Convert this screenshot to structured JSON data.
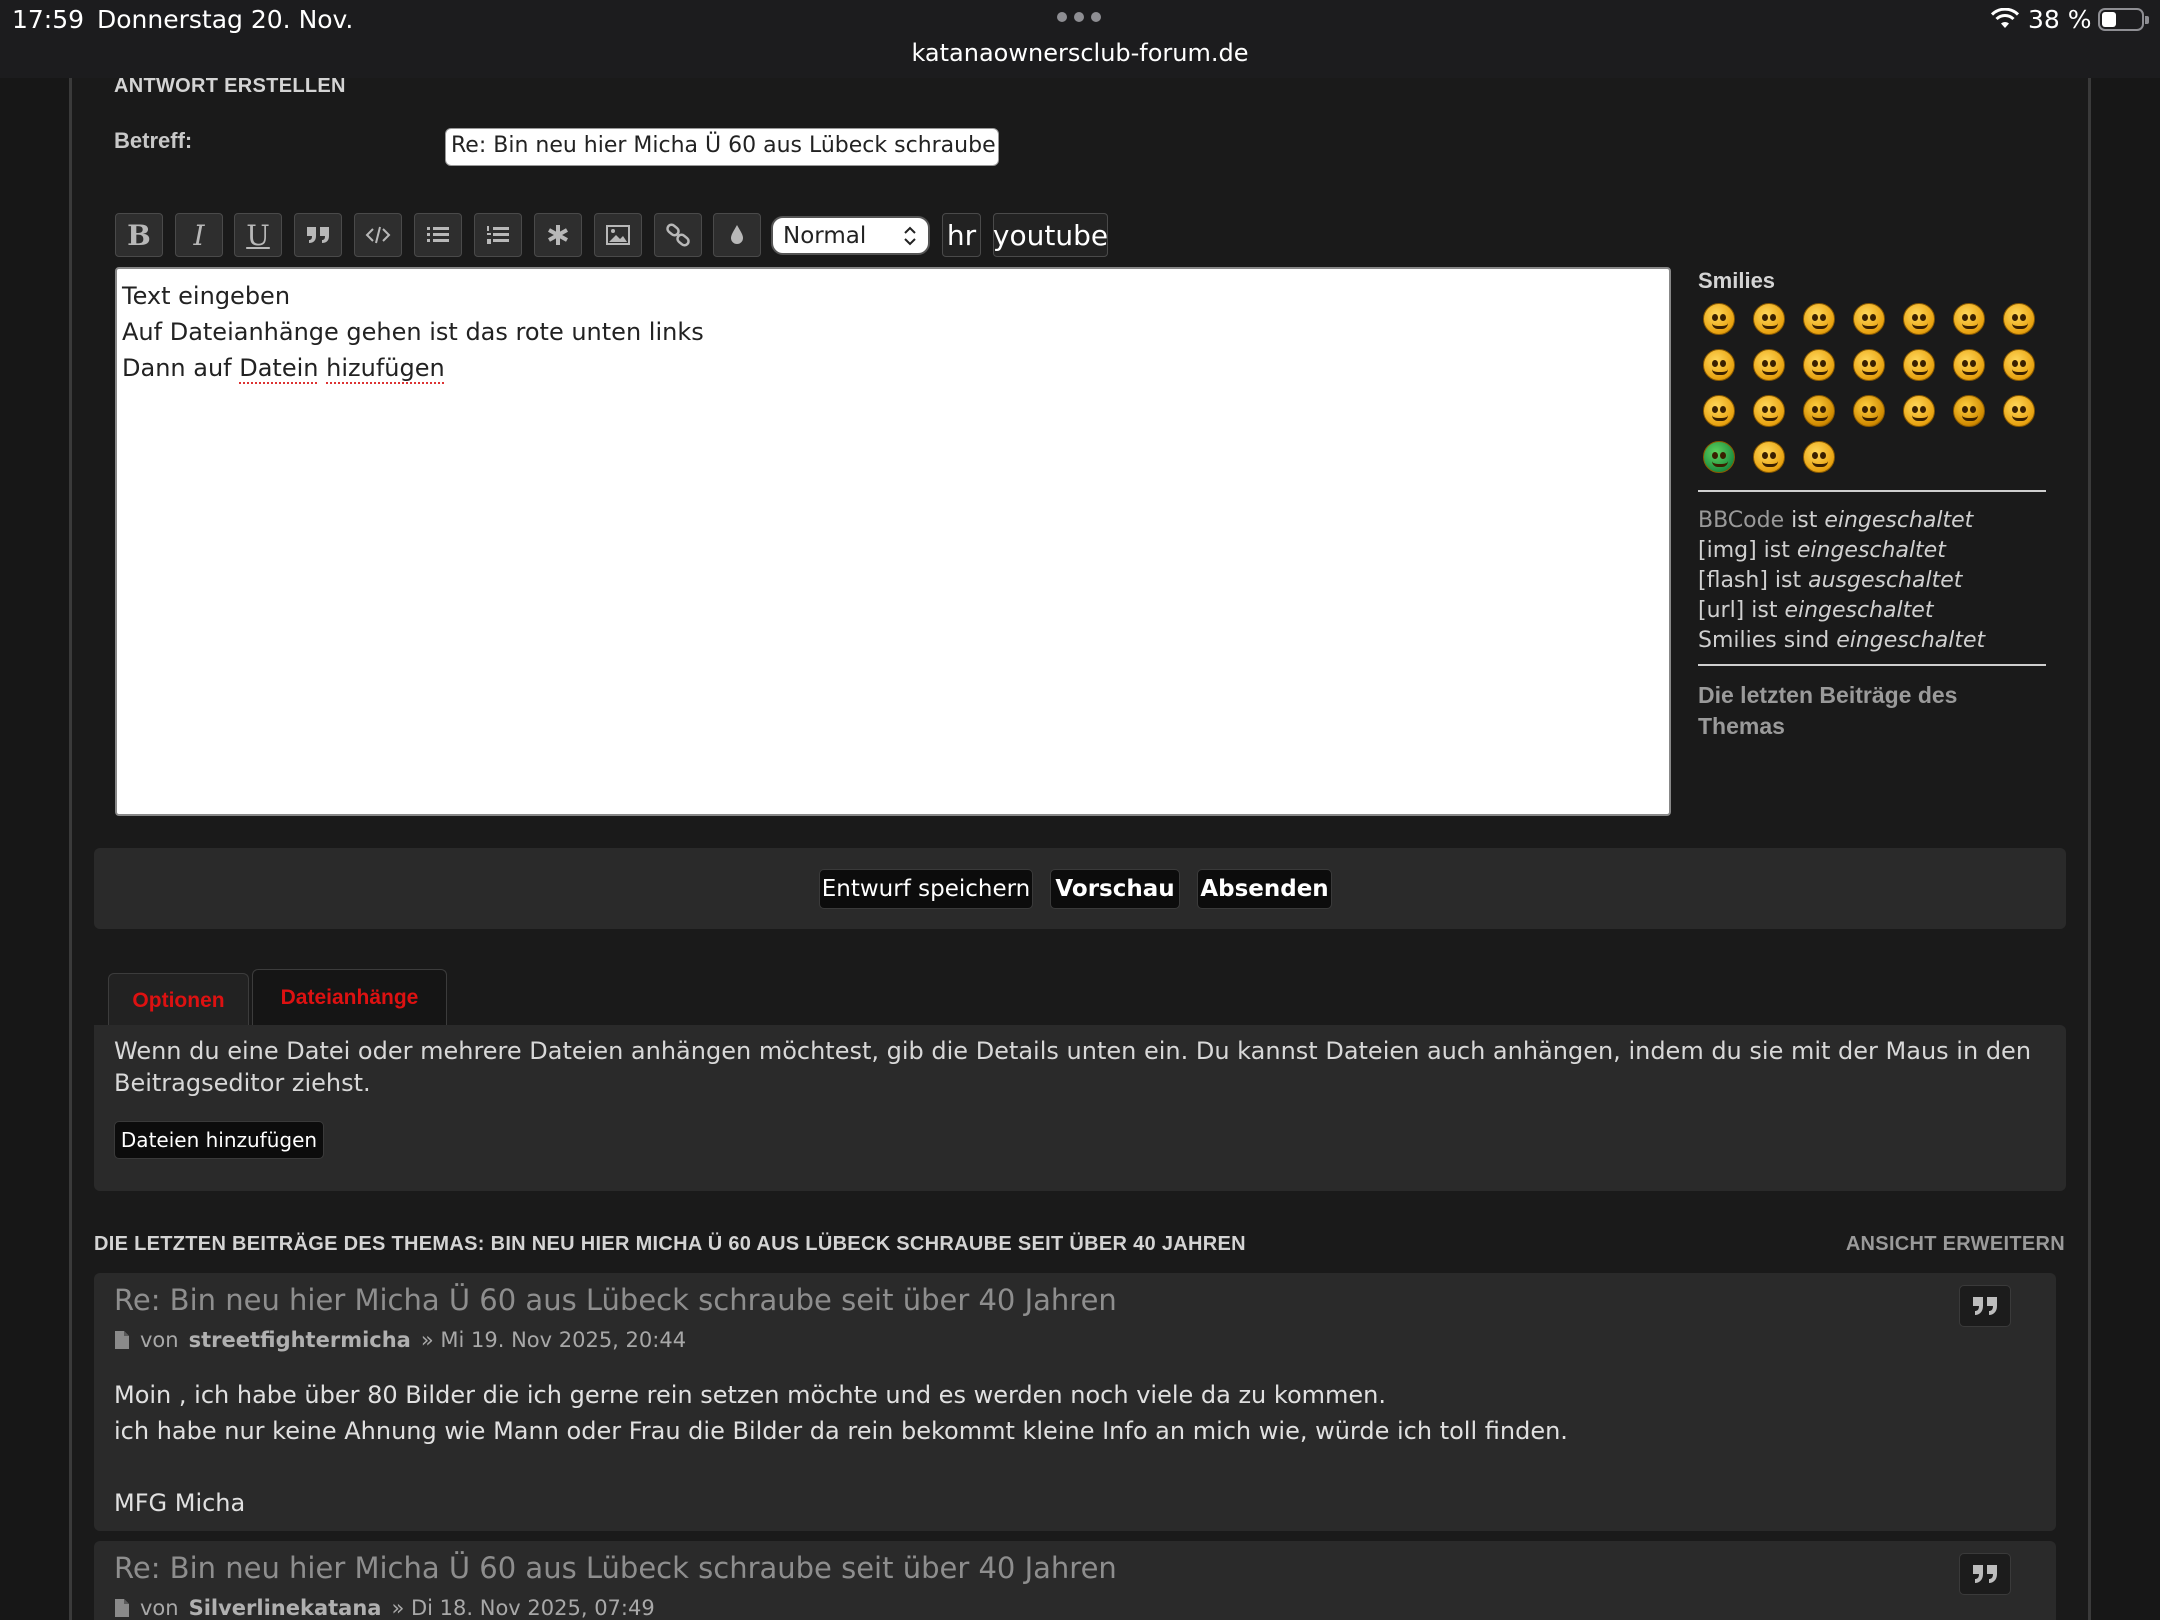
{
  "status_bar": {
    "time": "17:59",
    "date": "Donnerstag 20. Nov.",
    "url": "katanaownersclub-forum.de",
    "battery_percent": "38 %",
    "battery_level": 0.38
  },
  "reply_form": {
    "title": "ANTWORT ERSTELLEN",
    "subject_label": "Betreff:",
    "subject_value": "Re: Bin neu hier Micha Ü 60 aus Lübeck schraube seit über 40 Jahren",
    "toolbar": {
      "buttons": [
        {
          "name": "bold-button",
          "icon": "bold-icon",
          "glyph": "B"
        },
        {
          "name": "italic-button",
          "icon": "italic-icon",
          "glyph": "I"
        },
        {
          "name": "underline-button",
          "icon": "underline-icon",
          "glyph": "U"
        },
        {
          "name": "quote-button",
          "icon": "quote-icon"
        },
        {
          "name": "code-button",
          "icon": "code-icon"
        },
        {
          "name": "bullet-list-button",
          "icon": "list-icon"
        },
        {
          "name": "numbered-list-button",
          "icon": "numbered-list-icon"
        },
        {
          "name": "list-item-button",
          "icon": "asterisk-icon"
        },
        {
          "name": "image-button",
          "icon": "image-icon"
        },
        {
          "name": "link-button",
          "icon": "link-icon"
        },
        {
          "name": "color-button",
          "icon": "droplet-icon"
        }
      ],
      "font_size": "Normal",
      "hr_label": "hr",
      "youtube_label": "youtube"
    },
    "editor_lines": [
      "Text eingeben",
      "Auf Dateianhänge gehen ist das rote unten links",
      "Dann auf Datein hizufügen"
    ],
    "editor_line3_parts": [
      "Dann auf ",
      "Datein",
      " ",
      "hizufügen"
    ]
  },
  "sidebar": {
    "smilies_heading": "Smilies",
    "bbcode_status": [
      {
        "code": "BBCode",
        "text": " ist ",
        "state": "eingeschaltet"
      },
      {
        "code": "[img]",
        "text": " ist ",
        "state": "eingeschaltet"
      },
      {
        "code": "[flash]",
        "text": " ist ",
        "state": "ausgeschaltet"
      },
      {
        "code": "[url]",
        "text": " ist ",
        "state": "eingeschaltet"
      },
      {
        "code": "Smilies",
        "text": " sind ",
        "state": "eingeschaltet"
      }
    ],
    "last_posts_link": "Die letzten Beiträge des Themas"
  },
  "actions": {
    "save_draft": "Entwurf speichern",
    "preview": "Vorschau",
    "submit": "Absenden"
  },
  "tabs": [
    {
      "label": "Optionen",
      "active": false
    },
    {
      "label": "Dateianhänge",
      "active": true
    }
  ],
  "attachments": {
    "description": "Wenn du eine Datei oder mehrere Dateien anhängen möchtest, gib die Details unten ein. Du kannst Dateien auch anhängen, indem du sie mit der Maus in den Beitragseditor ziehst.",
    "add_files_label": "Dateien hinzufügen"
  },
  "recent_posts": {
    "heading": "DIE LETZTEN BEITRÄGE DES THEMAS: BIN NEU HIER MICHA Ü 60 AUS LÜBECK SCHRAUBE SEIT ÜBER 40 JAHREN",
    "expand_label": "ANSICHT ERWEITERN",
    "posts": [
      {
        "title": "Re: Bin neu hier Micha Ü 60 aus Lübeck schraube seit über 40 Jahren",
        "by": "von",
        "author": "streetfightermicha",
        "date": "» Mi 19. Nov 2025, 20:44",
        "body": "Moin , ich habe über 80 Bilder die ich gerne rein setzen möchte und es werden noch viele da zu kommen.\nich habe nur keine Ahnung wie Mann oder Frau die Bilder da rein bekommt kleine Info an mich wie, würde ich toll finden.\n\nMFG Micha"
      },
      {
        "title": "Re: Bin neu hier Micha Ü 60 aus Lübeck schraube seit über 40 Jahren",
        "by": "von",
        "author": "Silverlinekatana",
        "date": "» Di 18. Nov 2025, 07:49"
      }
    ]
  },
  "colors": {
    "background": "#171717",
    "panel": "#2a2a2a",
    "tab_text": "#dd1111",
    "muted_link": "#9a9a9a"
  }
}
